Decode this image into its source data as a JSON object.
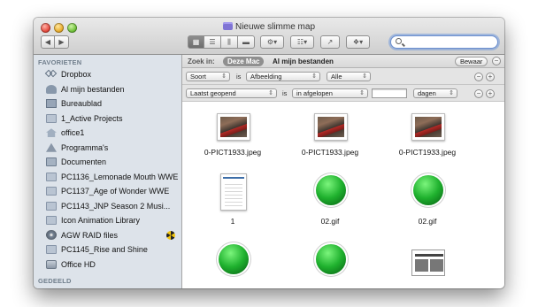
{
  "window": {
    "title": "Nieuwe slimme map"
  },
  "toolbar": {
    "back_glyph": "◀",
    "forward_glyph": "▶",
    "view_buttons": [
      "▦",
      "☰",
      "⫼",
      "▬"
    ],
    "action_glyph": "⚙▾",
    "arrange_glyph": "☷▾",
    "share_glyph": "↗",
    "dropbox_glyph": "❖▾",
    "search_value": ""
  },
  "sidebar": {
    "favorites_header": "FAVORIETEN",
    "items": [
      {
        "label": "Dropbox",
        "icon": "dropbox-icon"
      },
      {
        "label": "Al mijn bestanden",
        "icon": "all-files-icon"
      },
      {
        "label": "Bureaublad",
        "icon": "desktop-icon"
      },
      {
        "label": "1_Active Projects",
        "icon": "folder-icon"
      },
      {
        "label": "office1",
        "icon": "home-icon"
      },
      {
        "label": "Programma's",
        "icon": "applications-icon"
      },
      {
        "label": "Documenten",
        "icon": "documents-icon"
      },
      {
        "label": "PC1136_Lemonade Mouth WWE",
        "icon": "folder-icon"
      },
      {
        "label": "PC1137_Age of Wonder WWE",
        "icon": "folder-icon"
      },
      {
        "label": "PC1143_JNP Season 2 Musi...",
        "icon": "folder-icon"
      },
      {
        "label": "Icon Animation Library",
        "icon": "folder-icon"
      },
      {
        "label": "AGW RAID files",
        "icon": "disk-icon"
      },
      {
        "label": "PC1145_Rise and Shine",
        "icon": "folder-icon"
      },
      {
        "label": "Office HD",
        "icon": "hard-disk-icon"
      }
    ],
    "shared_header": "GEDEELD"
  },
  "search_scope": {
    "label": "Zoek in:",
    "active_scope": "Deze Mac",
    "other_scope": "Al mijn bestanden",
    "save_button": "Bewaar",
    "remove_glyph": "−"
  },
  "rules": [
    {
      "attribute": "Soort",
      "operator_text": "is",
      "value": "Afbeelding",
      "extra": "Alle",
      "remove": "−",
      "add": "+"
    },
    {
      "attribute": "Laatst geopend",
      "operator_text": "is",
      "value": "in afgelopen",
      "number": "",
      "unit": "dagen",
      "remove": "−",
      "add": "+"
    }
  ],
  "files": [
    {
      "name": "0-PICT1933.jpeg",
      "kind": "photo"
    },
    {
      "name": "0-PICT1933.jpeg",
      "kind": "photo"
    },
    {
      "name": "0-PICT1933.jpeg",
      "kind": "photo"
    },
    {
      "name": "1",
      "kind": "document"
    },
    {
      "name": "02.gif",
      "kind": "green-ball"
    },
    {
      "name": "02.gif",
      "kind": "green-ball"
    },
    {
      "name": "",
      "kind": "green-ball"
    },
    {
      "name": "",
      "kind": "green-ball"
    },
    {
      "name": "",
      "kind": "table-document"
    }
  ]
}
